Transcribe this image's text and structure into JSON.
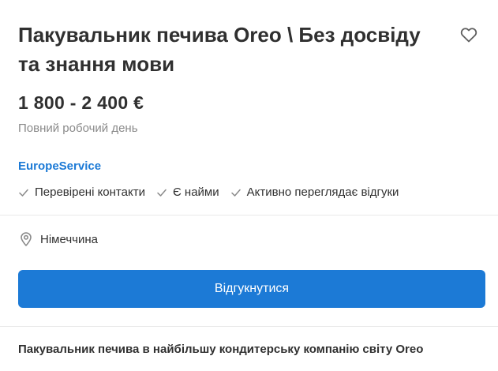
{
  "job": {
    "title": "Пакувальник печива Oreo \\ Без досвіду та знання мови",
    "salary": "1 800 - 2 400 €",
    "schedule": "Повний робочий день",
    "company": "EuropeService",
    "badges": [
      {
        "label": "Перевірені контакти",
        "icon": "check-icon"
      },
      {
        "label": "Є найми",
        "icon": "check-icon"
      },
      {
        "label": "Активно переглядає відгуки",
        "icon": "check-icon"
      }
    ],
    "location": "Німеччина",
    "apply_label": "Відгукнутися",
    "description_heading": "Пакувальник печива в найбільшу кондитерську компанію світу Oreo"
  },
  "colors": {
    "accent": "#1c7ad6",
    "text": "#303030",
    "muted": "#8a8a8a",
    "divider": "#e8e8e8"
  },
  "icons": {
    "favorite": "heart-outline-icon",
    "location": "map-pin-icon"
  }
}
